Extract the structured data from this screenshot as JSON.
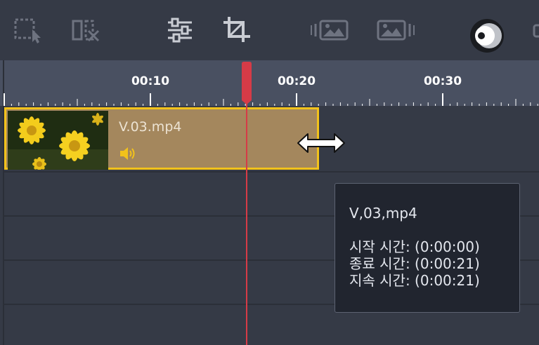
{
  "toolbar": {
    "icons": [
      {
        "name": "select-region-icon",
        "enabled": false
      },
      {
        "name": "split-clip-icon",
        "enabled": false
      },
      {
        "name": "adjust-settings-icon",
        "enabled": true
      },
      {
        "name": "crop-icon",
        "enabled": true
      },
      {
        "name": "fade-in-image-icon",
        "enabled": false
      },
      {
        "name": "fade-out-image-icon",
        "enabled": false
      },
      {
        "name": "view-toggle-icon",
        "enabled": true
      }
    ]
  },
  "ruler": {
    "labels": [
      "00:10",
      "00:20",
      "00:30"
    ]
  },
  "clip": {
    "name": "V.03.mp4",
    "has_audio": true
  },
  "tooltip": {
    "name": "V,03,mp4",
    "start": "시작 시간: (0:00:00)",
    "end": "종료 시간: (0:00:21)",
    "duration": "지속 시간: (0:00:21)"
  },
  "colors": {
    "toolbar_bg": "#353a46",
    "ruler_bg": "#495061",
    "clip_fill": "#a4875d",
    "clip_border": "#f2c21b",
    "playhead": "#d63b47",
    "icon_enabled": "#c9ccd3",
    "icon_disabled": "#6e7380"
  }
}
